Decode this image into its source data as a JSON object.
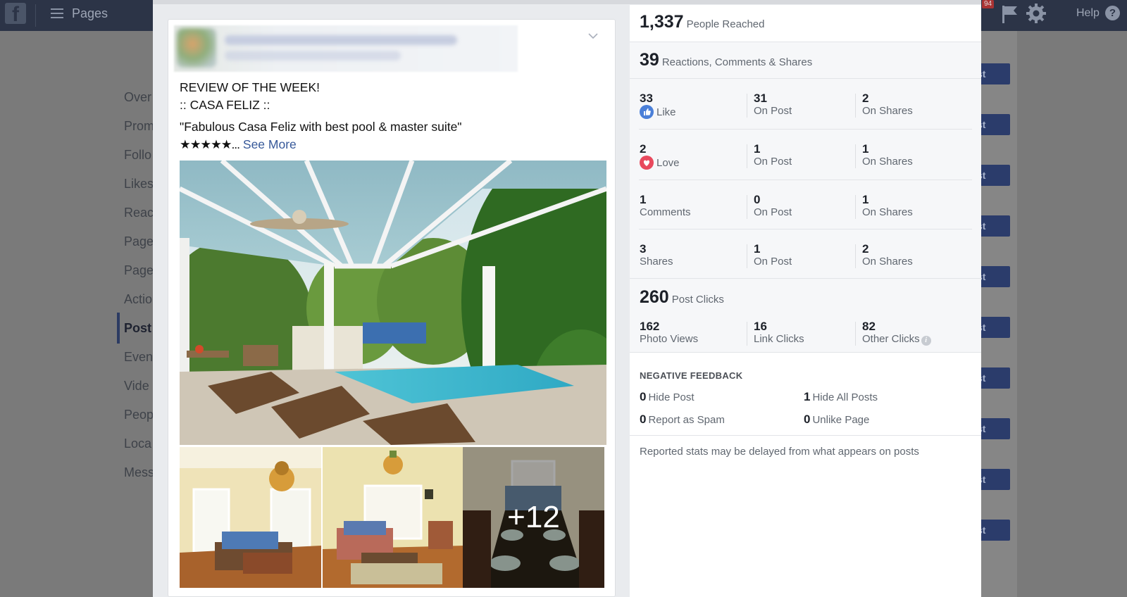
{
  "topbar": {
    "title": "Pages",
    "notification_count": "94",
    "help_label": "Help"
  },
  "background_nav": {
    "items": [
      "Over",
      "Prom",
      "Follo",
      "Likes",
      "Reac",
      "Page",
      "Page",
      "Actio",
      "Post",
      "Even",
      "Vide",
      "Peop",
      "Loca",
      "Mess"
    ],
    "active_index": 8
  },
  "background_buttons": {
    "label": "st"
  },
  "post": {
    "line1": "REVIEW OF THE WEEK!",
    "line2": ":: CASA FELIZ ::",
    "quote": "\"Fabulous Casa Feliz with best pool & master suite\"",
    "stars": "★★★★★...",
    "see_more": "See More",
    "more_photos": "+12"
  },
  "stats": {
    "reach_value": "1,337",
    "reach_label": "People Reached",
    "engagement_value": "39",
    "engagement_label": "Reactions, Comments & Shares",
    "rows": [
      {
        "total": "33",
        "label": "Like",
        "icon": "like-icon",
        "on_post": "31",
        "on_post_label": "On Post",
        "on_shares": "2",
        "on_shares_label": "On Shares"
      },
      {
        "total": "2",
        "label": "Love",
        "icon": "love-icon",
        "on_post": "1",
        "on_post_label": "On Post",
        "on_shares": "1",
        "on_shares_label": "On Shares"
      },
      {
        "total": "1",
        "label": "Comments",
        "on_post": "0",
        "on_post_label": "On Post",
        "on_shares": "1",
        "on_shares_label": "On Shares"
      },
      {
        "total": "3",
        "label": "Shares",
        "on_post": "1",
        "on_post_label": "On Post",
        "on_shares": "2",
        "on_shares_label": "On Shares"
      }
    ],
    "clicks_value": "260",
    "clicks_label": "Post Clicks",
    "clicks": [
      {
        "value": "162",
        "label": "Photo Views"
      },
      {
        "value": "16",
        "label": "Link Clicks"
      },
      {
        "value": "82",
        "label": "Other Clicks"
      }
    ],
    "negative_title": "NEGATIVE FEEDBACK",
    "negative": [
      {
        "value": "0",
        "label": "Hide Post"
      },
      {
        "value": "1",
        "label": "Hide All Posts"
      },
      {
        "value": "0",
        "label": "Report as Spam"
      },
      {
        "value": "0",
        "label": "Unlike Page"
      }
    ],
    "note": "Reported stats may be delayed from what appears on posts"
  },
  "colors": {
    "topbar": "#2c3447",
    "link": "#365899",
    "like": "#4a7fd8",
    "love": "#e8495d",
    "button": "#2b3c6b"
  }
}
